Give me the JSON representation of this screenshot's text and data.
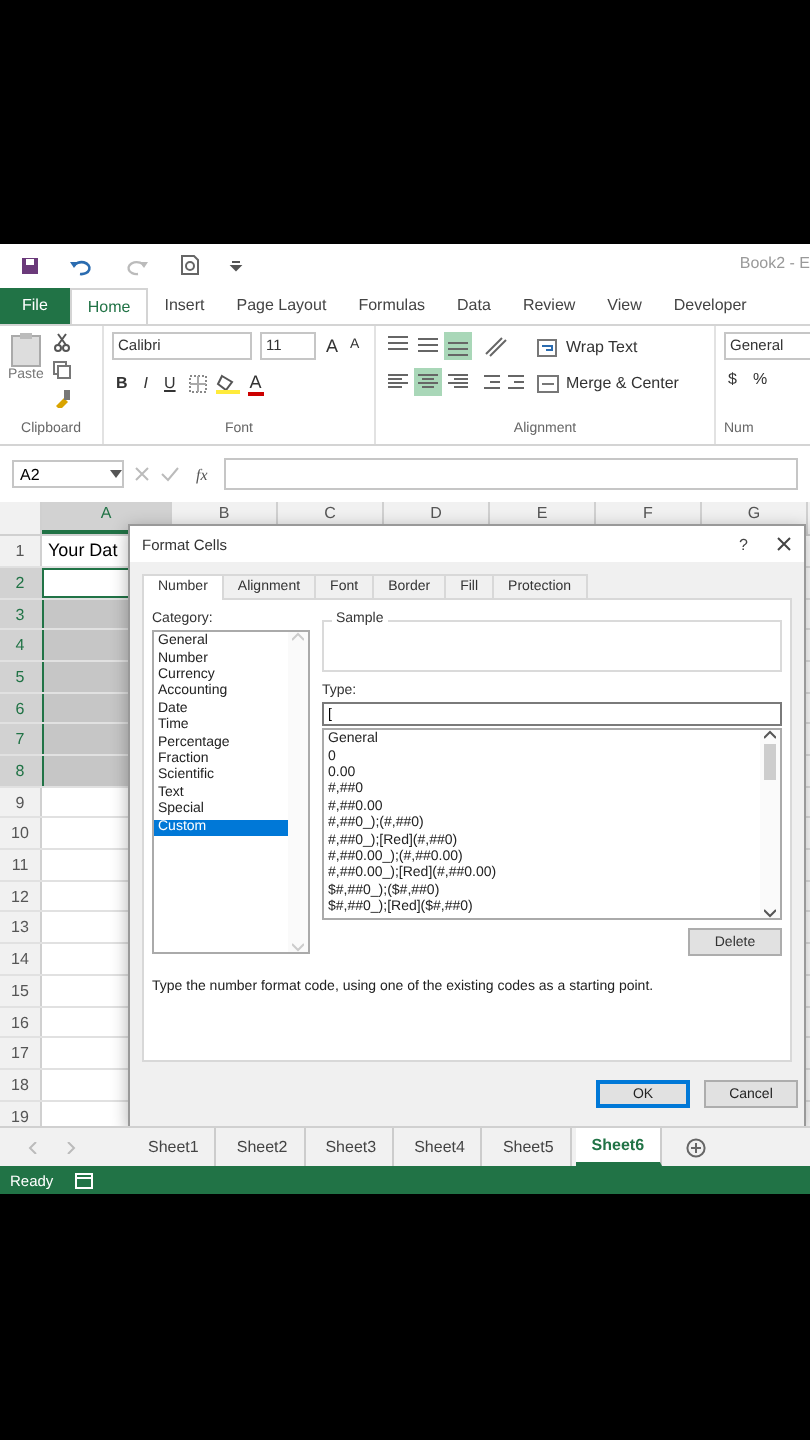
{
  "title_bar": {
    "title": "Book2 - E"
  },
  "ribbon_tabs": [
    {
      "label": "File",
      "kind": "file",
      "selected": false
    },
    {
      "label": "Home",
      "kind": "tab",
      "selected": true
    },
    {
      "label": "Insert",
      "kind": "tab",
      "selected": false
    },
    {
      "label": "Page Layout",
      "kind": "tab",
      "selected": false
    },
    {
      "label": "Formulas",
      "kind": "tab",
      "selected": false
    },
    {
      "label": "Data",
      "kind": "tab",
      "selected": false
    },
    {
      "label": "Review",
      "kind": "tab",
      "selected": false
    },
    {
      "label": "View",
      "kind": "tab",
      "selected": false
    },
    {
      "label": "Developer",
      "kind": "tab",
      "selected": false
    }
  ],
  "ribbon": {
    "paste": "Paste",
    "font_name": "Calibri",
    "font_size": "11",
    "grow_font": "A",
    "shrink_font": "A",
    "bold": "B",
    "italic": "I",
    "underline": "U",
    "font_color": "A",
    "wrap_text": "Wrap Text",
    "merge_center": "Merge & Center",
    "number_format": "General",
    "currency": "$",
    "percent": "%",
    "vertical_align": [
      {
        "kind": "top",
        "on": false
      },
      {
        "kind": "middle",
        "on": false
      },
      {
        "kind": "bottom",
        "on": true
      }
    ],
    "horizontal_align": [
      {
        "kind": "left",
        "on": false
      },
      {
        "kind": "center",
        "on": true
      },
      {
        "kind": "right",
        "on": false
      }
    ],
    "groups": [
      "Clipboard",
      "Font",
      "Alignment",
      "Num"
    ]
  },
  "formula_bar": {
    "name_box": "A2",
    "fx": "fx"
  },
  "sheet": {
    "columns": [
      {
        "label": "A",
        "selected": true
      },
      {
        "label": "B",
        "selected": false
      },
      {
        "label": "C",
        "selected": false
      },
      {
        "label": "D",
        "selected": false
      },
      {
        "label": "E",
        "selected": false
      },
      {
        "label": "F",
        "selected": false
      },
      {
        "label": "G",
        "selected": false
      }
    ],
    "rows": [
      {
        "number": "1",
        "cell_a": "Your Dat",
        "selected": false,
        "active": false
      },
      {
        "number": "2",
        "selected": true,
        "active": true
      },
      {
        "number": "3",
        "selected": true,
        "active": false
      },
      {
        "number": "4",
        "selected": true,
        "active": false
      },
      {
        "number": "5",
        "selected": true,
        "active": false
      },
      {
        "number": "6",
        "selected": true,
        "active": false
      },
      {
        "number": "7",
        "selected": true,
        "active": false
      },
      {
        "number": "8",
        "selected": true,
        "active": false
      },
      {
        "number": "9",
        "selected": false,
        "active": false
      },
      {
        "number": "10",
        "selected": false,
        "active": false
      },
      {
        "number": "11",
        "selected": false,
        "active": false
      },
      {
        "number": "12",
        "selected": false,
        "active": false
      },
      {
        "number": "13",
        "selected": false,
        "active": false
      },
      {
        "number": "14",
        "selected": false,
        "active": false
      },
      {
        "number": "15",
        "selected": false,
        "active": false
      },
      {
        "number": "16",
        "selected": false,
        "active": false
      },
      {
        "number": "17",
        "selected": false,
        "active": false
      },
      {
        "number": "18",
        "selected": false,
        "active": false
      },
      {
        "number": "19",
        "selected": false,
        "active": false
      }
    ]
  },
  "dialog": {
    "title": "Format Cells",
    "help": "?",
    "tabs": [
      {
        "label": "Number",
        "selected": true
      },
      {
        "label": "Alignment",
        "selected": false
      },
      {
        "label": "Font",
        "selected": false
      },
      {
        "label": "Border",
        "selected": false
      },
      {
        "label": "Fill",
        "selected": false
      },
      {
        "label": "Protection",
        "selected": false
      }
    ],
    "category_label": "Category:",
    "categories": [
      {
        "label": "General",
        "selected": false
      },
      {
        "label": "Number",
        "selected": false
      },
      {
        "label": "Currency",
        "selected": false
      },
      {
        "label": "Accounting",
        "selected": false
      },
      {
        "label": "Date",
        "selected": false
      },
      {
        "label": "Time",
        "selected": false
      },
      {
        "label": "Percentage",
        "selected": false
      },
      {
        "label": "Fraction",
        "selected": false
      },
      {
        "label": "Scientific",
        "selected": false
      },
      {
        "label": "Text",
        "selected": false
      },
      {
        "label": "Special",
        "selected": false
      },
      {
        "label": "Custom",
        "selected": true
      }
    ],
    "sample_label": "Sample",
    "type_label": "Type:",
    "type_value": "[",
    "formats": [
      "General",
      "0",
      "0.00",
      "#,##0",
      "#,##0.00",
      "#,##0_);(#,##0)",
      "#,##0_);[Red](#,##0)",
      "#,##0.00_);(#,##0.00)",
      "#,##0.00_);[Red](#,##0.00)",
      "$#,##0_);($#,##0)",
      "$#,##0_);[Red]($#,##0)"
    ],
    "delete_button": "Delete",
    "description": "Type the number format code, using one of the existing codes as a starting point.",
    "buttons": [
      {
        "label": "OK",
        "kind": "default"
      },
      {
        "label": "Cancel",
        "kind": "normal"
      }
    ]
  },
  "sheet_tabs": [
    {
      "label": "Sheet1",
      "selected": false
    },
    {
      "label": "Sheet2",
      "selected": false
    },
    {
      "label": "Sheet3",
      "selected": false
    },
    {
      "label": "Sheet4",
      "selected": false
    },
    {
      "label": "Sheet5",
      "selected": false
    },
    {
      "label": "Sheet6",
      "selected": true
    }
  ],
  "status_bar": {
    "text": "Ready"
  }
}
